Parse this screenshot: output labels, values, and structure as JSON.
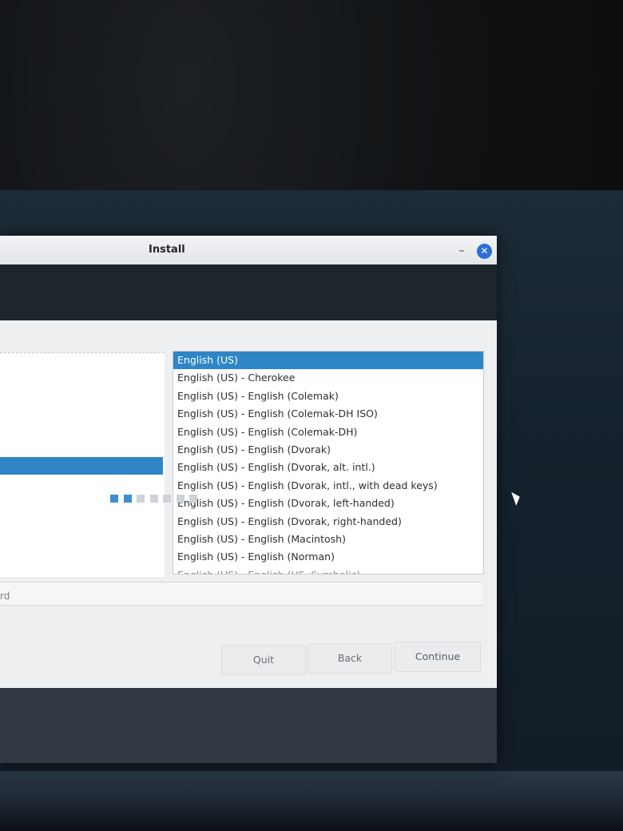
{
  "window": {
    "title": "Install",
    "minimize_glyph": "–",
    "close_glyph": "✕"
  },
  "left_pane": {
    "partial_label": "rd"
  },
  "layout_list": {
    "items": [
      "English (US)",
      "English (US) - Cherokee",
      "English (US) - English (Colemak)",
      "English (US) - English (Colemak-DH ISO)",
      "English (US) - English (Colemak-DH)",
      "English (US) - English (Dvorak)",
      "English (US) - English (Dvorak, alt. intl.)",
      "English (US) - English (Dvorak, intl., with dead keys)",
      "English (US) - English (Dvorak, left-handed)",
      "English (US) - English (Dvorak, right-handed)",
      "English (US) - English (Macintosh)",
      "English (US) - English (Norman)",
      "English (US) - English (US, Symbolic)"
    ],
    "selected_index": 0
  },
  "buttons": {
    "quit": "Quit",
    "back": "Back",
    "continue": "Continue"
  },
  "progress": {
    "total_steps": 7,
    "completed_steps": 2
  },
  "colors": {
    "accent": "#2f86c6",
    "close_button": "#2a6fd6"
  }
}
